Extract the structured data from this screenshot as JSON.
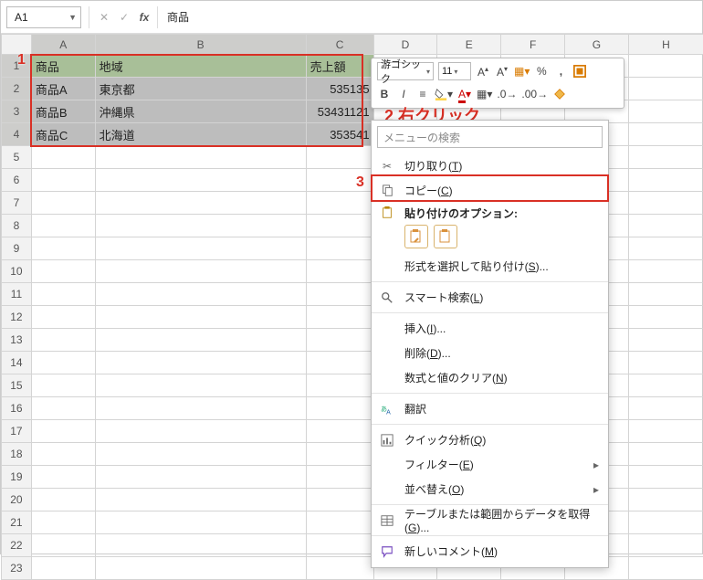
{
  "namebox": {
    "ref": "A1"
  },
  "formula_bar": {
    "value": "商品"
  },
  "columns": [
    "A",
    "B",
    "C",
    "D",
    "E",
    "F",
    "G",
    "H"
  ],
  "rows_count": 23,
  "data": {
    "header": {
      "c1": "商品",
      "c2": "地域",
      "c3": "売上額"
    },
    "rows": [
      {
        "c1": "商品A",
        "c2": "東京都",
        "c3": "535135"
      },
      {
        "c1": "商品B",
        "c2": "沖縄県",
        "c3": "53431121"
      },
      {
        "c1": "商品C",
        "c2": "北海道",
        "c3": "353541"
      }
    ]
  },
  "mini_toolbar": {
    "font": "游ゴシック",
    "size": "11",
    "bold": "B",
    "italic": "I"
  },
  "annotations": {
    "a1": "1",
    "a2": "2 右クリック",
    "a3": "3"
  },
  "ctx": {
    "search_placeholder": "メニューの検索",
    "cut": "切り取り(T)",
    "copy": "コピー(C)",
    "paste_options_label": "貼り付けのオプション:",
    "paste_special": "形式を選択して貼り付け(S)...",
    "smart_lookup": "スマート検索(L)",
    "insert": "挿入(I)...",
    "delete": "削除(D)...",
    "clear": "数式と値のクリア(N)",
    "translate": "翻訳",
    "quick_analysis": "クイック分析(Q)",
    "filter": "フィルター(E)",
    "sort": "並べ替え(O)",
    "from_table": "テーブルまたは範囲からデータを取得(G)...",
    "new_comment": "新しいコメント(M)"
  }
}
